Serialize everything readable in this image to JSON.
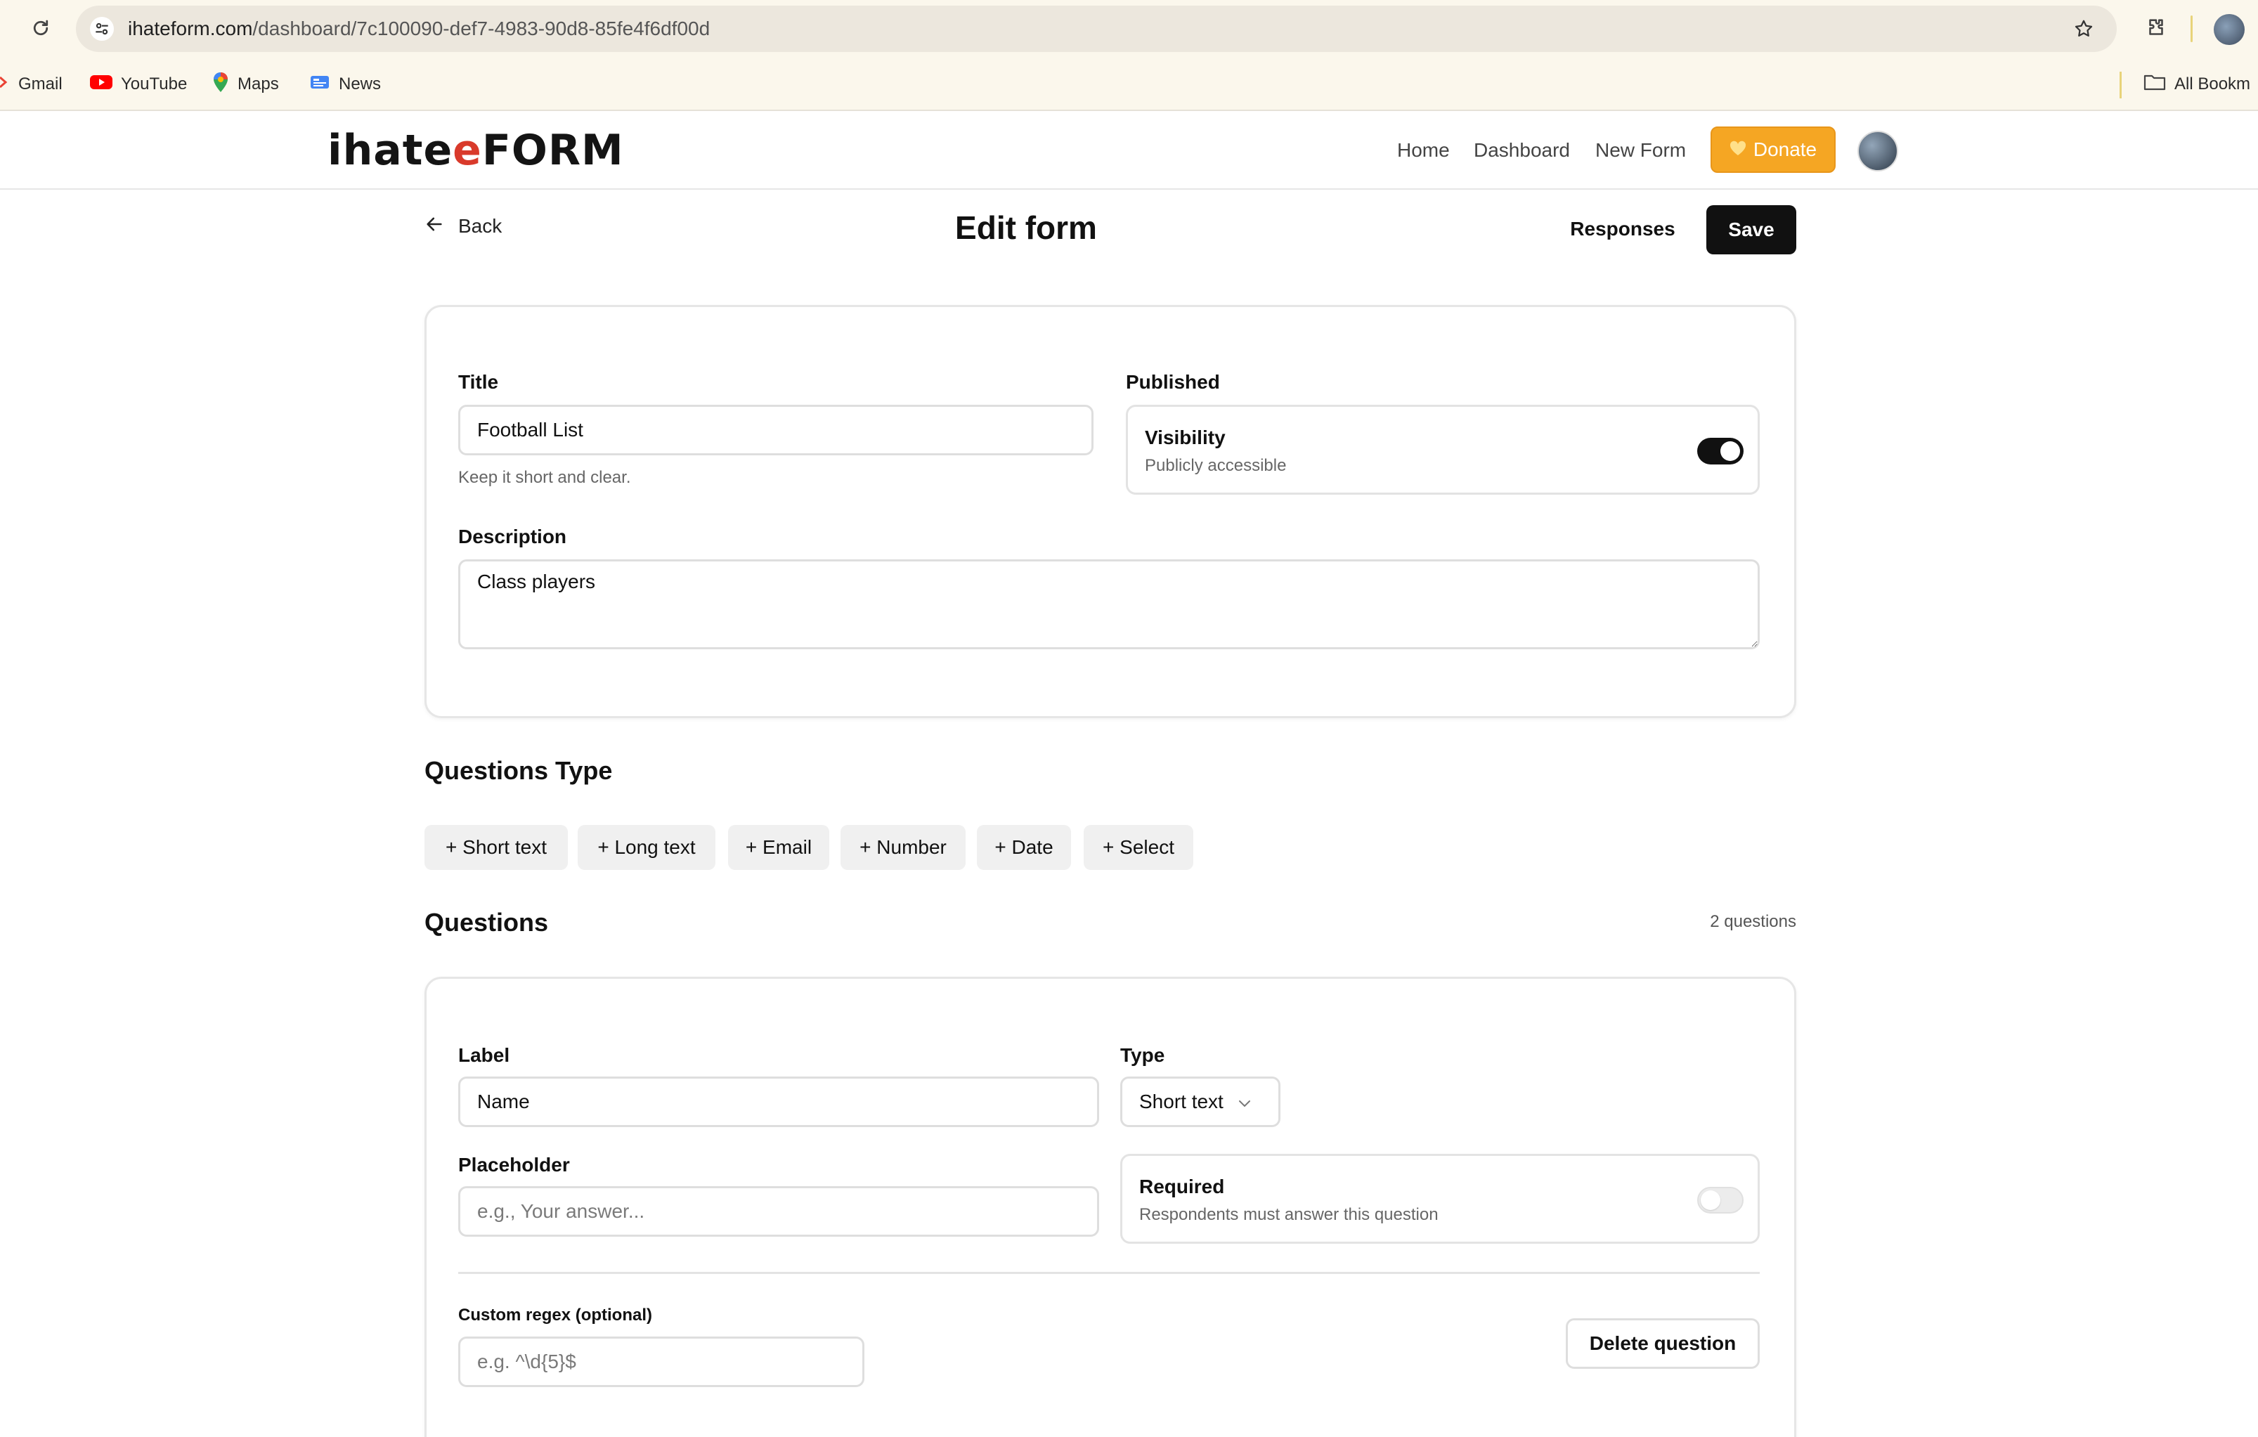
{
  "browser": {
    "url_host": "ihateform.com",
    "url_path": "/dashboard/7c100090-def7-4983-90d8-85fe4f6df00d",
    "bookmarks": [
      {
        "label": "Gmail",
        "icon": "gmail-icon"
      },
      {
        "label": "YouTube",
        "icon": "youtube-icon"
      },
      {
        "label": "Maps",
        "icon": "maps-icon"
      },
      {
        "label": "News",
        "icon": "news-icon"
      }
    ],
    "all_bookmarks_label": "All Bookm"
  },
  "header": {
    "logo_part1": "ihate",
    "logo_accent": "e",
    "logo_part2": "FORM",
    "nav": {
      "home": "Home",
      "dashboard": "Dashboard",
      "new_form": "New Form"
    },
    "donate_label": "Donate",
    "donate_color": "#f5a623"
  },
  "page": {
    "back_label": "Back",
    "title": "Edit form",
    "responses_label": "Responses",
    "save_label": "Save"
  },
  "form": {
    "title_label": "Title",
    "title_value": "Football List",
    "title_hint": "Keep it short and clear.",
    "published_label": "Published",
    "visibility_title": "Visibility",
    "visibility_sub": "Publicly accessible",
    "visibility_on": true,
    "description_label": "Description",
    "description_value": "Class players"
  },
  "question_types": {
    "heading": "Questions Type",
    "items": [
      "+ Short text",
      "+ Long text",
      "+ Email",
      "+ Number",
      "+ Date",
      "+ Select"
    ]
  },
  "questions": {
    "heading": "Questions",
    "count_label": "2 questions",
    "first": {
      "label_label": "Label",
      "label_value": "Name",
      "type_label": "Type",
      "type_value": "Short text",
      "placeholder_label": "Placeholder",
      "placeholder_placeholder": "e.g., Your answer...",
      "required_title": "Required",
      "required_sub": "Respondents must answer this question",
      "required_on": false,
      "regex_label": "Custom regex (optional)",
      "regex_placeholder": "e.g. ^\\d{5}$",
      "delete_label": "Delete question"
    }
  }
}
